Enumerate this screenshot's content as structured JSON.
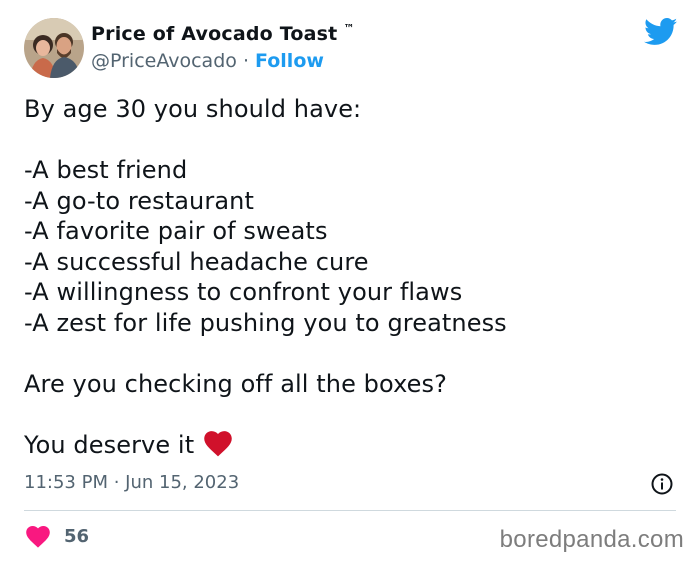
{
  "author": {
    "display_name": "Price of Avocado Toast",
    "trademark": "™",
    "handle": "@PriceAvocado",
    "separator": "·",
    "follow_label": "Follow"
  },
  "tweet": {
    "lines": [
      "By age 30 you should have:",
      "",
      "-A best friend",
      "-A go-to restaurant",
      "-A favorite pair of sweats",
      "-A successful headache cure",
      "-A willingness to confront your flaws",
      "-A zest for life pushing you to greatness",
      "",
      "Are you checking off all the boxes?",
      "",
      "You deserve it"
    ],
    "timestamp": "11:53 PM · Jun 15, 2023"
  },
  "engagement": {
    "like_count": "56"
  },
  "watermark": "boredpanda.com",
  "icons": {
    "brand": "twitter-bird-icon",
    "info": "info-icon",
    "like": "heart-icon",
    "emoji": "red-heart-emoji"
  },
  "colors": {
    "text": "#0f1419",
    "secondary": "#536471",
    "accent": "#1d9bf0",
    "like": "#f91880",
    "divider": "#cfd9de",
    "emoji_heart": "#d0112b"
  }
}
